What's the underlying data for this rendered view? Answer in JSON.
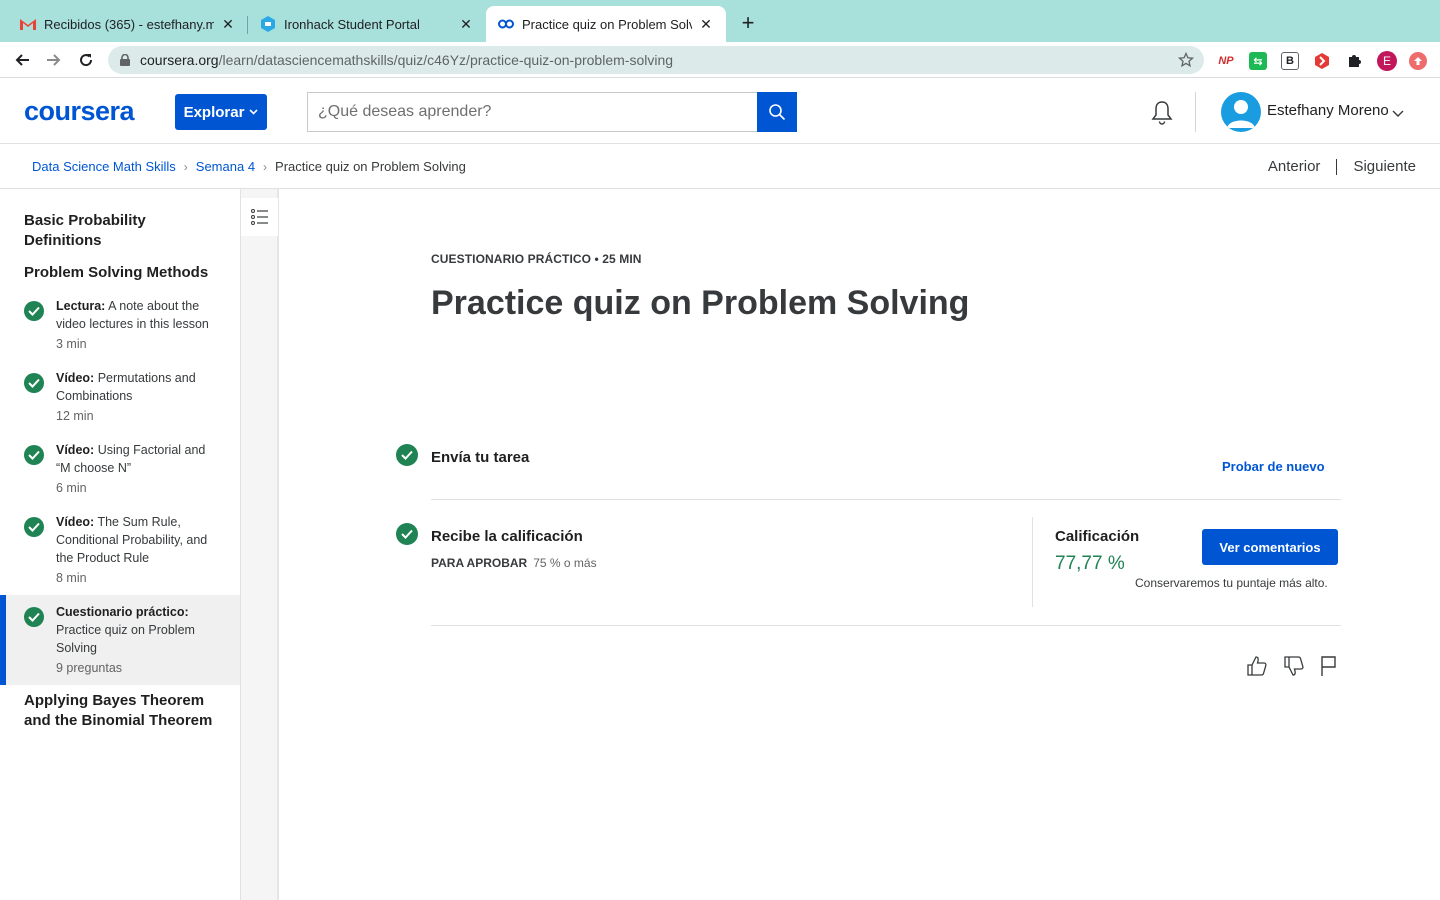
{
  "browser": {
    "tabs": [
      {
        "title": "Recibidos (365) - estefhany.m",
        "icon": "gmail-icon"
      },
      {
        "title": "Ironhack Student Portal",
        "icon": "ironhack-icon"
      },
      {
        "title": "Practice quiz on Problem Solvin",
        "icon": "coursera-icon",
        "active": true
      }
    ],
    "url_host": "coursera.org",
    "url_path": "/learn/datasciencemathskills/quiz/c46Yz/practice-quiz-on-problem-solving",
    "extensions": [
      "NP",
      "",
      "B",
      "",
      "",
      "E",
      ""
    ]
  },
  "header": {
    "logo": "coursera",
    "explore_label": "Explorar",
    "search_placeholder": "¿Qué deseas aprender?",
    "user_name": "Estefhany Moreno"
  },
  "breadcrumb": {
    "items": [
      "Data Science Math Skills",
      "Semana 4",
      "Practice quiz on Problem Solving"
    ],
    "prev_label": "Anterior",
    "next_label": "Siguiente"
  },
  "sidebar": {
    "sections": [
      "Basic Probability Definitions",
      "Problem Solving Methods",
      "Applying Bayes Theorem and the Binomial Theorem"
    ],
    "items": [
      {
        "type": "Lectura:",
        "title": "A note about the video lectures in this lesson",
        "duration": "3 min"
      },
      {
        "type": "Vídeo:",
        "title": "Permutations and Combinations",
        "duration": "12 min"
      },
      {
        "type": "Vídeo:",
        "title": "Using Factorial and “M choose N”",
        "duration": "6 min"
      },
      {
        "type": "Vídeo:",
        "title": "The Sum Rule, Conditional Probability, and the Product Rule",
        "duration": "8 min"
      },
      {
        "type": "Cuestionario práctico:",
        "title": "Practice quiz on Problem Solving",
        "duration": "9 preguntas"
      }
    ]
  },
  "main": {
    "kicker": "CUESTIONARIO PRÁCTICO • 25 MIN",
    "title": "Practice quiz on Problem Solving",
    "step1_title": "Envía tu tarea",
    "retry_label": "Probar de nuevo",
    "step2_title": "Recibe la calificación",
    "pass_label": "PARA APROBAR",
    "pass_value": "75 % o más",
    "grade_label": "Calificación",
    "grade_value": "77,77 %",
    "feedback_button": "Ver comentarios",
    "keep_note": "Conservaremos tu puntaje más alto."
  },
  "colors": {
    "brand": "#0056d2",
    "success": "#1f8354",
    "chrome_tabbar": "#a8e0dc"
  }
}
